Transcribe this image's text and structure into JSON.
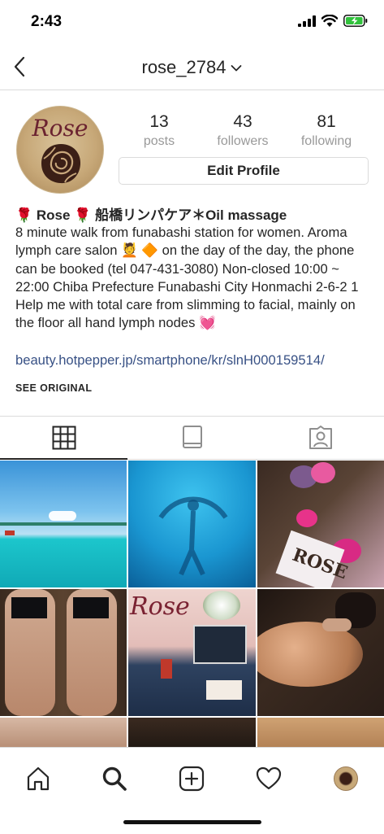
{
  "status_bar": {
    "time": "2:43"
  },
  "nav": {
    "username": "rose_2784"
  },
  "profile": {
    "avatar_text": "Rose",
    "stats": [
      {
        "value": "13",
        "label": "posts"
      },
      {
        "value": "43",
        "label": "followers"
      },
      {
        "value": "81",
        "label": "following"
      }
    ],
    "edit_button": "Edit Profile"
  },
  "bio": {
    "name": "🌹 Rose 🌹 船橋リンパケア＊Oil massage",
    "text": "8 minute walk from funabashi station for women. Aroma lymph care salon 💆 🔶 on the day of the day, the phone can be booked (tel 047-431-3080) Non-closed 10:00 ~ 22:00 Chiba Prefecture Funabashi City Honmachi 2-6-2 1 Help me with total care from slimming to facial, mainly on the floor all hand lymph nodes 💓",
    "link": "beauty.hotpepper.jp/smartphone/kr/slnH000159514/",
    "see_original": "SEE ORIGINAL"
  },
  "tabs": [
    {
      "icon": "grid-icon",
      "active": true
    },
    {
      "icon": "igtv-icon",
      "active": false
    },
    {
      "icon": "tagged-icon",
      "active": false
    }
  ],
  "grid": {
    "tiles": [
      {
        "subject": "beach-ocean",
        "colors": [
          "#5fb3e6",
          "#1ec2c9"
        ]
      },
      {
        "subject": "underwater-swimmer",
        "colors": [
          "#1b9fd4",
          "#0b6fae"
        ]
      },
      {
        "subject": "flowers-rose-sign",
        "colors": [
          "#3a2a22",
          "#d4a9b6"
        ]
      },
      {
        "subject": "leg-massage",
        "colors": [
          "#4a3526",
          "#c9a188"
        ]
      },
      {
        "subject": "rose-salon-entrance",
        "colors": [
          "#e8c9c6",
          "#2b3d5a"
        ]
      },
      {
        "subject": "back-massage",
        "colors": [
          "#2a1e18",
          "#c58a63"
        ]
      }
    ],
    "tile_sign_text": "Rose",
    "tile_small_text": "ROSE"
  },
  "bottom_nav": [
    {
      "icon": "home-icon"
    },
    {
      "icon": "search-icon"
    },
    {
      "icon": "new-post-icon"
    },
    {
      "icon": "activity-heart-icon"
    },
    {
      "icon": "profile-avatar-icon"
    }
  ],
  "colors": {
    "link": "#385185",
    "divider": "#dbdbdb",
    "text": "#262626",
    "muted": "#999999"
  }
}
